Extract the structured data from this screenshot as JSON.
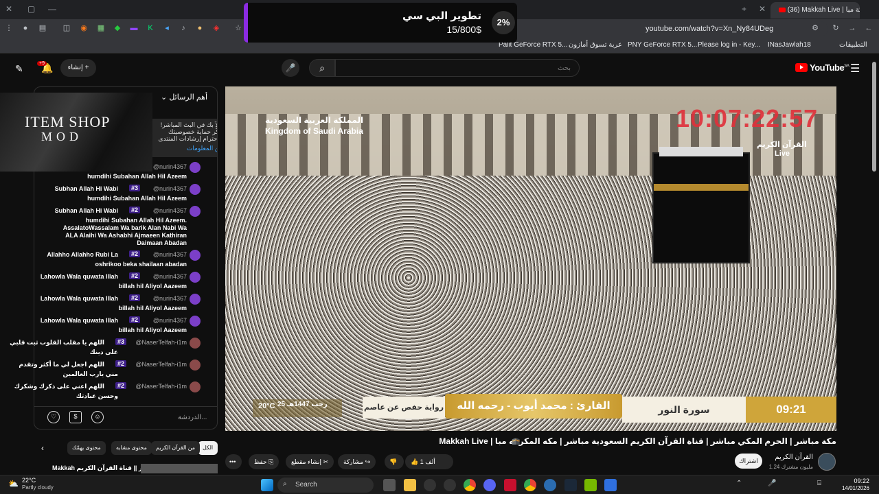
{
  "browser": {
    "active_tab": "(36) Makkah Live | مكة مبا",
    "url": "youtube.com/watch?v=Xn_Ny84UDeg",
    "bookmarks": [
      "التطبيقات",
      "INasJawlah18",
      "Please log in - Key...",
      "PNY GeForce RTX 5...",
      "عربة تسوق أمازون",
      "Palit GeForce RTX 5..."
    ]
  },
  "notification": {
    "percent": "2%",
    "title": "تطوير البي سي",
    "amount": "15/800$",
    "accent": "#8b2be2"
  },
  "header": {
    "logo": "YouTube",
    "logo_region": "SA",
    "search_placeholder": "بحث",
    "create_label": "إنشاء",
    "notif_count": "+9"
  },
  "overlay": {
    "title": "ITEM SHOP",
    "subtitle": "MOD"
  },
  "chat": {
    "header": "أهم الرسائل",
    "pinned_text": "أهلاً بك في البث المباشر! تذكّر حماية خصوصيتك واحترام إرشادات المنتدى.",
    "pinned_more": "مزيد من المعلومات",
    "input_placeholder": "الدردشة...",
    "messages": [
      {
        "user": "@nurin4367",
        "badge": "",
        "lead": "",
        "text": "humdihi Subahan Allah Hil Azeem"
      },
      {
        "user": "@nurin4367",
        "badge": "#3",
        "lead": "Subhan Allah Hi Wabi",
        "text": "humdihi Subahan Allah Hil Azeem"
      },
      {
        "user": "@nurin4367",
        "badge": "#2",
        "lead": "Subhan Allah Hi Wabi",
        "text": "humdihi Subahan Allah Hil Azeem. AssalatoWassalam Wa barik Alan Nabi Wa ALA Alaihi Wa Ashabhi Ajmaeen Kathiran Daimaan Abadan"
      },
      {
        "user": "@nurin4367",
        "badge": "#2",
        "lead": "Allahho Allahho Rubi La",
        "text": "oshrikoo beka shailaan abadan"
      },
      {
        "user": "@nurin4367",
        "badge": "#2",
        "lead": "Lahowla Wala quwata Illah",
        "text": "billah hil Aliyol Aazeem"
      },
      {
        "user": "@nurin4367",
        "badge": "#2",
        "lead": "Lahowla Wala quwata Illah",
        "text": "billah hil Aliyol Aazeem"
      },
      {
        "user": "@nurin4367",
        "badge": "#2",
        "lead": "Lahowla Wala quwata Illah",
        "text": "billah hil Aliyol Aazeem"
      },
      {
        "user": "@NaserTelfah-i1m",
        "badge": "#3",
        "lead": "اللهم يا مقلب القلوب ثبت قلبي",
        "text": "على دينك"
      },
      {
        "user": "@NaserTelfah-i1m",
        "badge": "#2",
        "lead": "اللهم اجعل لي ما أكثر وتقدم",
        "text": "مني يارب العالمين"
      },
      {
        "user": "@NaserTelfah-i1m",
        "badge": "#2",
        "lead": "اللهم اعني على ذكرك وشكرك",
        "text": "وحسن عبادتك"
      }
    ]
  },
  "video": {
    "country_ar": "المملكة العربية السعودية",
    "country_en": "Kingdom of Saudi Arabia",
    "clock": "10:07:22:57",
    "channel_ar": "القرآن الكريم",
    "live": "Live",
    "time": "09:21",
    "surah": "سورة النور",
    "qari": "القارئ : محمد أيوب - رحمه الله",
    "riwaya": "رواية حفص عن عاصم",
    "hijri": "25 رجب 1447هـ",
    "temp": "20°C"
  },
  "below": {
    "title": "Makkah Live | مكة مباشر | الحرم المكي مباشر | قناة القرآن الكريم السعودية مباشر | مكه المكرمه مبا",
    "channel": "القرآن الكريم",
    "subs": "1.24 مليون مشترك",
    "subscribe": "اشتراك",
    "like_count": "1 ألف",
    "share": "مشاركة",
    "clip": "إنشاء مقطع",
    "save": "حفظ",
    "chips": [
      "الكل",
      "من القرآن الكريم",
      "محتوى مشابه",
      "محتوى يهمّك"
    ],
    "rec_title": "Makkah بث مباشر || قناة القرآن الكريم"
  },
  "taskbar": {
    "temp": "22°C",
    "weather": "Partly cloudy",
    "search": "Search",
    "time": "09:22",
    "date": "14/01/2026"
  }
}
